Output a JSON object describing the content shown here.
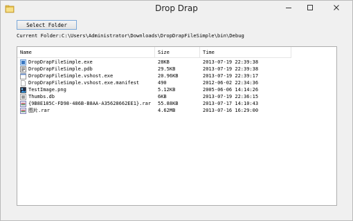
{
  "window": {
    "title": "Drop Drap",
    "icon": "folder-icon"
  },
  "toolbar": {
    "select_label": "Select Folder"
  },
  "current_folder": "Current Folder:C:\\Users\\Administrator\\Downloads\\DropDrapFileSimple\\bin\\Debug",
  "list": {
    "columns": [
      "Name",
      "Size",
      "Time"
    ],
    "rows": [
      {
        "name": "DropDrapFileSimple.exe",
        "size": "28KB",
        "time": "2013-07-19 22:39:38",
        "icon": "exe-icon"
      },
      {
        "name": "DropDrapFileSimple.pdb",
        "size": "29.5KB",
        "time": "2013-07-19 22:39:38",
        "icon": "pdb-icon"
      },
      {
        "name": "DropDrapFileSimple.vshost.exe",
        "size": "20.96KB",
        "time": "2013-07-19 22:39:17",
        "icon": "app-icon"
      },
      {
        "name": "DropDrapFileSimple.vshost.exe.manifest",
        "size": "490",
        "time": "2012-06-02 22:34:36",
        "icon": "document-icon"
      },
      {
        "name": "TestImage.png",
        "size": "5.12KB",
        "time": "2005-06-06 14:14:26",
        "icon": "image-icon"
      },
      {
        "name": "Thumbs.db",
        "size": "6KB",
        "time": "2013-07-19 22:36:15",
        "icon": "db-icon"
      },
      {
        "name": "{9B8E185C-FD98-486B-B8AA-A35628662EE1}.rar",
        "size": "55.88KB",
        "time": "2013-07-17 14:10:43",
        "icon": "archive-icon"
      },
      {
        "name": "图片.rar",
        "size": "4.62MB",
        "time": "2013-07-16 16:29:00",
        "icon": "archive-icon"
      }
    ]
  }
}
